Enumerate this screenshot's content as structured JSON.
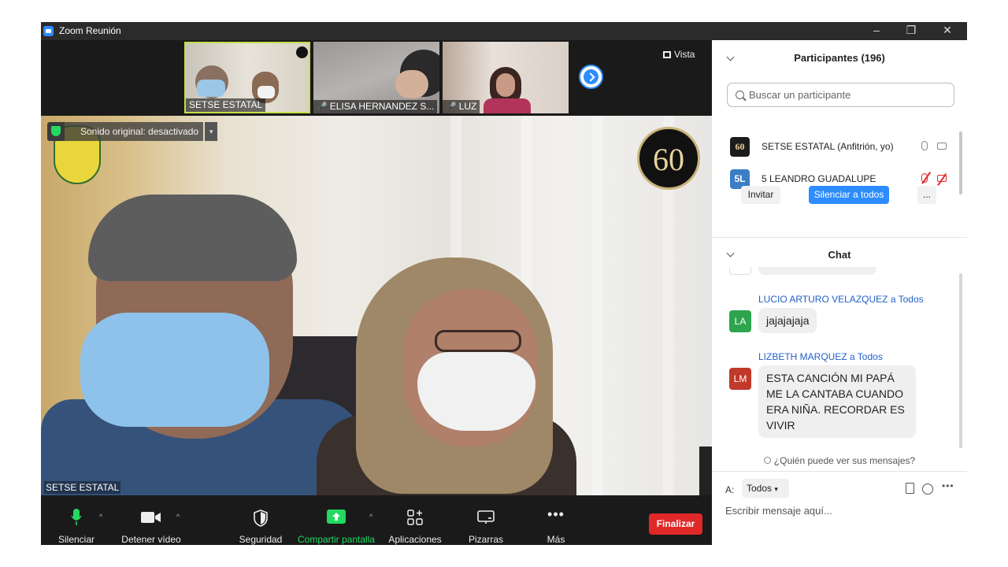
{
  "window": {
    "title": "Zoom Reunión",
    "controls": [
      "–",
      "❐",
      "✕"
    ]
  },
  "thumbnails": [
    {
      "name": "SETSE ESTATAL",
      "muted": false
    },
    {
      "name": "ELISA HERNANDEZ S...",
      "muted": true
    },
    {
      "name": "LUZ",
      "muted": true
    }
  ],
  "view_button": "Vista",
  "main_video": {
    "original_sound": "Sonido original: desactivado",
    "speaker_name": "SETSE ESTATAL",
    "badge": "60"
  },
  "toolbar": {
    "mute": "Silenciar",
    "video": "Detener vídeo",
    "security": "Seguridad",
    "share": "Compartir pantalla",
    "apps": "Aplicaciones",
    "whiteboards": "Pizarras",
    "more": "Más",
    "end": "Finalizar"
  },
  "participants": {
    "title": "Participantes (196)",
    "search_placeholder": "Buscar un participante",
    "list": [
      {
        "avatar": "60",
        "name": "SETSE ESTATAL (Anfitrión, yo)",
        "color": "#1c1c1c"
      },
      {
        "avatar": "5L",
        "name": "5 LEANDRO GUADALUPE",
        "color": "#3b7ec7"
      }
    ],
    "invite": "Invitar",
    "mute_all": "Silenciar a todos",
    "more": "..."
  },
  "chat": {
    "title": "Chat",
    "messages": [
      {
        "avatar": "LA",
        "sender": "LUCIO ARTURO VELAZQUEZ a Todos",
        "text": "jajajajaja",
        "color": "#2ea44f"
      },
      {
        "avatar": "LM",
        "sender": "LIZBETH MARQUEZ a Todos",
        "lines": [
          "ESTA CANCIÓN MI PAPÁ",
          "ME LA CANTABA CUANDO",
          "ERA NIÑA. RECORDAR ES",
          "VIVIR"
        ],
        "color": "#c0392b"
      }
    ],
    "who_can_see": "¿Quién puede ver sus mensajes?",
    "to_label": "A:",
    "to_value": "Todos",
    "input_placeholder": "Escribir mensaje aquí..."
  }
}
